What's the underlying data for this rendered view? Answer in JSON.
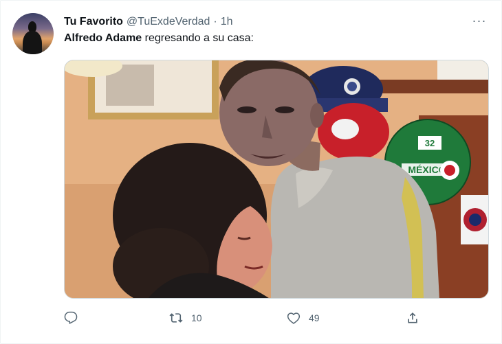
{
  "tweet": {
    "author_name": "Tu Favorito",
    "handle": "@TuExdeVerdad",
    "separator": "·",
    "time": "1h",
    "more_label": "···",
    "text_mention": "Alfredo Adame",
    "text_rest": " regresando a su casa:",
    "media_ball_text": "MÉXICO",
    "media_ball_number": "32",
    "actions": {
      "reply_count": "",
      "retweet_count": "10",
      "like_count": "49"
    },
    "icons": [
      "reply-icon",
      "retweet-icon",
      "like-icon",
      "share-icon",
      "more-icon"
    ],
    "colors": {
      "text": "#0f1419",
      "secondary": "#536471",
      "border": "#cfd9de"
    }
  }
}
